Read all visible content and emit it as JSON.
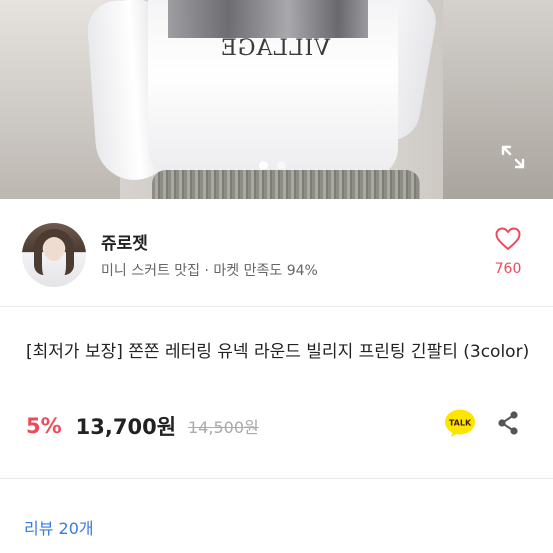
{
  "gallery": {
    "image_alt": "product photo",
    "print_text": "VILLAGE",
    "page_count": 2,
    "active_page": 1
  },
  "seller": {
    "name": "쥬로젯",
    "subtitle": "미니 스커트 맛집 · 마켓 만족도 94%",
    "likes": "760"
  },
  "product": {
    "title": "[최저가 보장] 쫀쫀 레터링 유넥 라운드 빌리지 프린팅 긴팔티 (3color)",
    "discount": "5%",
    "price": "13,700원",
    "original_price": "14,500원"
  },
  "share": {
    "kakao_label": "TALK"
  },
  "reviews": {
    "link_label": "리뷰 20개"
  },
  "colors": {
    "accent_red": "#ef4a5a",
    "link_blue": "#3a7be0",
    "kakao_yellow": "#fee500"
  }
}
